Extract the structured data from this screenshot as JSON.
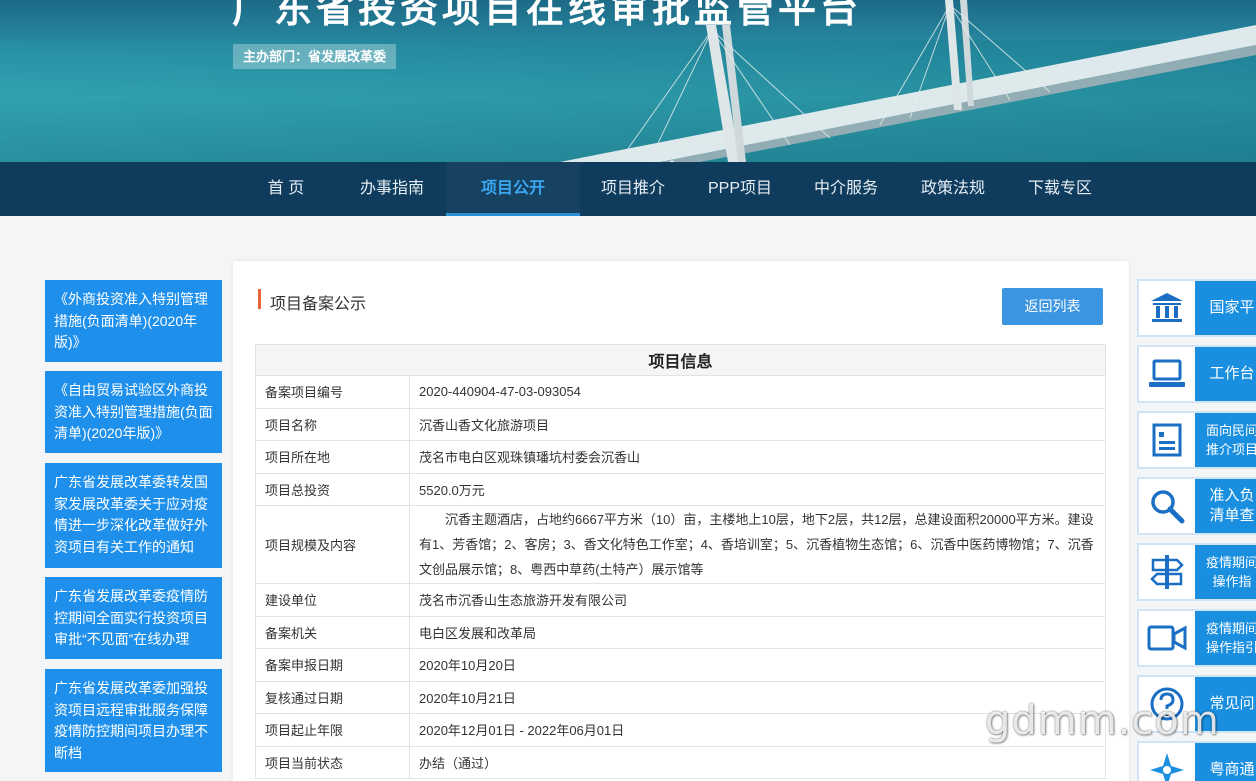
{
  "banner": {
    "title": "广东省投资项目在线审批监管平台",
    "department": "主办部门：省发展改革委"
  },
  "nav": {
    "items": [
      "首 页",
      "办事指南",
      "项目公开",
      "项目推介",
      "PPP项目",
      "中介服务",
      "政策法规",
      "下载专区"
    ],
    "active": "项目公开"
  },
  "left_links": [
    "《外商投资准入特别管理措施(负面清单)(2020年版)》",
    "《自由贸易试验区外商投资准入特别管理措施(负面清单)(2020年版)》",
    "广东省发展改革委转发国家发展改革委关于应对疫情进一步深化改革做好外资项目有关工作的通知",
    "广东省发展改革委疫情防控期间全面实行投资项目审批“不见面”在线办理",
    "广东省发展改革委加强投资项目远程审批服务保障疫情防控期间项目办理不断档"
  ],
  "panel": {
    "section_title": "项目备案公示",
    "back_button": "返回列表",
    "table_title": "项目信息",
    "rows": [
      {
        "label": "备案项目编号",
        "value": "2020-440904-47-03-093054"
      },
      {
        "label": "项目名称",
        "value": "沉香山香文化旅游项目"
      },
      {
        "label": "项目所在地",
        "value": "茂名市电白区观珠镇璠坑村委会沉香山"
      },
      {
        "label": "项目总投资",
        "value": "5520.0万元"
      },
      {
        "label": "项目规模及内容",
        "value": "沉香主题酒店，占地约6667平方米（10）亩，主楼地上10层，地下2层，共12层，总建设面积20000平方米。建设有1、芳香馆；2、客房；3、香文化特色工作室；4、香培训室；5、沉香植物生态馆；6、沉香中医药博物馆；7、沉香文创品展示馆；8、粤西中草药(土特产）展示馆等"
      },
      {
        "label": "建设单位",
        "value": "茂名市沉香山生态旅游开发有限公司"
      },
      {
        "label": "备案机关",
        "value": "电白区发展和改革局"
      },
      {
        "label": "备案申报日期",
        "value": "2020年10月20日"
      },
      {
        "label": "复核通过日期",
        "value": "2020年10月21日"
      },
      {
        "label": "项目起止年限",
        "value": "2020年12月01日 - 2022年06月01日"
      },
      {
        "label": "项目当前状态",
        "value": "办结（通过）"
      }
    ]
  },
  "right_tiles": [
    {
      "label": "国家平",
      "icon": "building-icon"
    },
    {
      "label": "工作台",
      "icon": "laptop-icon"
    },
    {
      "label": "面向民间\n推介项目",
      "icon": "document-list-icon"
    },
    {
      "label": "准入负\n清单查",
      "icon": "search-icon"
    },
    {
      "label": "疫情期间\n操作指",
      "icon": "signpost-icon"
    },
    {
      "label": "疫情期间\n操作指引",
      "icon": "video-icon"
    },
    {
      "label": "常见问",
      "icon": "question-icon"
    },
    {
      "label": "粤商通",
      "icon": "app-logo-icon"
    }
  ],
  "watermark": "gdmm.com",
  "colors": {
    "nav_bg": "#0f3b5c",
    "accent": "#1e90ec",
    "active_nav": "#3aa8f0",
    "title_marker": "#e8633a"
  }
}
